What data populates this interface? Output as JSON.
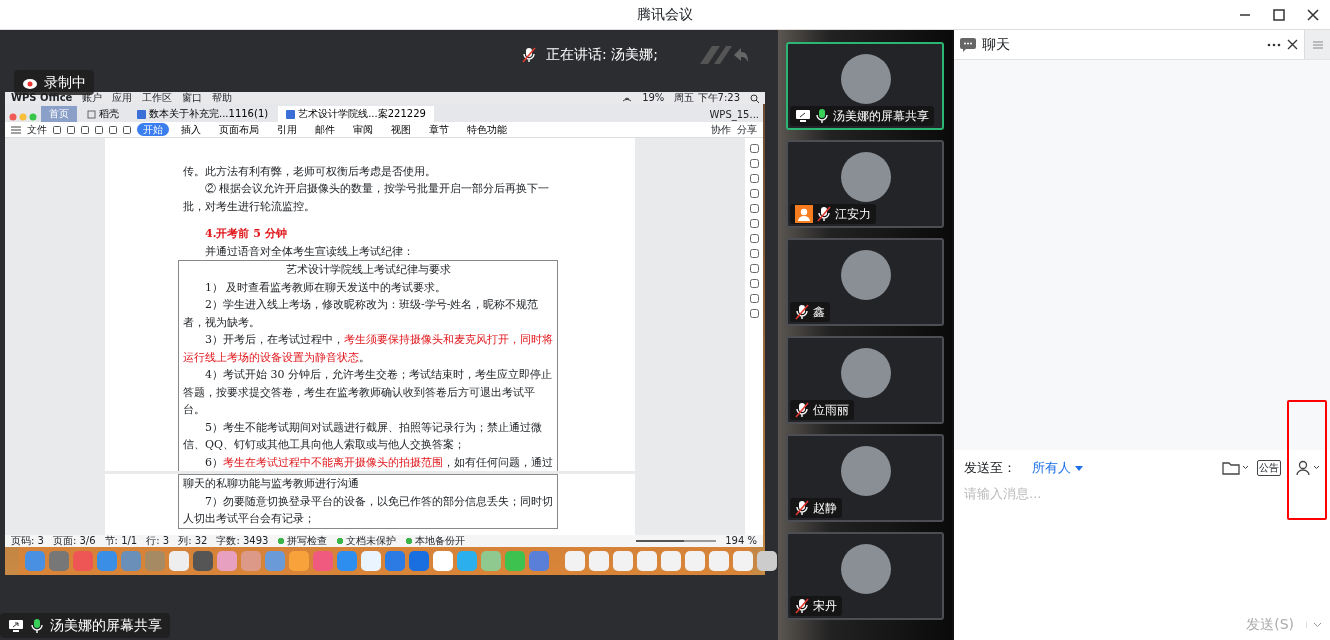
{
  "window": {
    "title": "腾讯会议"
  },
  "share": {
    "recording_label": "录制中",
    "speaker_label": "正在讲话: 汤美娜;",
    "presenter_label": "汤美娜的屏幕共享",
    "screen": {
      "menubar": {
        "app": "WPS Office",
        "menus": [
          "账户",
          "应用",
          "工作区",
          "窗口",
          "帮助"
        ],
        "battery": "19%",
        "clock": "周五 下午7:23"
      },
      "tabs": [
        {
          "label": "首页",
          "kind": "home",
          "selected": false
        },
        {
          "label": "稻壳",
          "kind": "store",
          "selected": false
        },
        {
          "label": "数本关于补充完...1116(1)",
          "kind": "doc",
          "selected": false
        },
        {
          "label": "艺术设计学院线...案221229",
          "kind": "doc",
          "selected": true
        }
      ],
      "account": "WPS_15...",
      "ribbon": {
        "file": "文件",
        "items": [
          {
            "label": "开始",
            "selected": true
          },
          {
            "label": "插入",
            "selected": false
          },
          {
            "label": "页面布局",
            "selected": false
          },
          {
            "label": "引用",
            "selected": false
          },
          {
            "label": "邮件",
            "selected": false
          },
          {
            "label": "审阅",
            "selected": false
          },
          {
            "label": "视图",
            "selected": false
          },
          {
            "label": "章节",
            "selected": false
          },
          {
            "label": "特色功能",
            "selected": false
          }
        ],
        "actions": [
          "协作",
          "分享"
        ]
      },
      "document": {
        "pages": [
          {
            "items": [
              {
                "kind": "continuation",
                "parts": [
                  {
                    "text": "传。此方法有利有弊，老师可权衡后考虑是否使用。",
                    "red": false
                  }
                ]
              },
              {
                "kind": "body",
                "parts": [
                  {
                    "text": "② 根据会议允许开启摄像头的数量，按学号批量开启一部分后再换下一批，对考生进行轮流监控。",
                    "red": false
                  }
                ]
              },
              {
                "kind": "heading",
                "parts": [
                  {
                    "text": "4.开考前 5 分钟",
                    "red": true
                  }
                ]
              },
              {
                "kind": "body",
                "parts": [
                  {
                    "text": "并通过语音对全体考生宣读线上考试纪律：",
                    "red": false
                  }
                ]
              },
              {
                "kind": "box",
                "items": [
                  {
                    "kind": "title",
                    "parts": [
                      {
                        "text": "艺术设计学院线上考试纪律与要求",
                        "red": false
                      }
                    ]
                  },
                  {
                    "kind": "body",
                    "parts": [
                      {
                        "text": "1） 及时查看监考教师在聊天发送中的考试要求。",
                        "red": false
                      }
                    ]
                  },
                  {
                    "kind": "body",
                    "parts": [
                      {
                        "text": "2）学生进入线上考场，修改昵称改为：班级-学号-姓名，昵称不规范者，视为缺考。",
                        "red": false
                      }
                    ]
                  },
                  {
                    "kind": "body",
                    "parts": [
                      {
                        "text": "3）开考后，在考试过程中，",
                        "red": false
                      },
                      {
                        "text": "考生须要保持摄像头和麦克风打开，同时将运行线上考场的设备设置为静音状态",
                        "red": true
                      },
                      {
                        "text": "。",
                        "red": false
                      }
                    ]
                  },
                  {
                    "kind": "body",
                    "parts": [
                      {
                        "text": "4）考试开始 30 分钟后，允许考生交卷；考试结束时，考生应立即停止答题，按要求提交答卷，考生在监考教师确认收到答卷后方可退出考试平台。",
                        "red": false
                      }
                    ]
                  },
                  {
                    "kind": "body",
                    "parts": [
                      {
                        "text": "5）考生不能考试期间对试题进行截屏、拍照等记录行为；禁止通过微信、QQ、钉钉或其他工具向他人索取或与他人交换答案；",
                        "red": false
                      }
                    ]
                  },
                  {
                    "kind": "body",
                    "parts": [
                      {
                        "text": "6）",
                        "red": false
                      },
                      {
                        "text": "考生在考试过程中不能离开摄像头的拍摄范围",
                        "red": true
                      },
                      {
                        "text": "，如有任何问题，通过",
                        "red": false
                      }
                    ]
                  }
                ]
              }
            ]
          },
          {
            "items": [
              {
                "kind": "box",
                "items": [
                  {
                    "kind": "continuation",
                    "parts": [
                      {
                        "text": "聊天的私聊功能与监考教师进行沟通",
                        "red": false
                      }
                    ]
                  },
                  {
                    "kind": "body",
                    "parts": [
                      {
                        "text": "7）勿要随意切换登录平台的设备，以免已作答的部分信息丢失；同时切人切出考试平台会有记录；",
                        "red": false
                      }
                    ]
                  }
                ]
              }
            ]
          }
        ]
      },
      "status": [
        "页码: 3",
        "页面: 3/6",
        "节: 1/1",
        "行: 3",
        "列: 32",
        "字数: 3493"
      ],
      "status_checks": [
        "拼写检查",
        "文档未保护",
        "本地备份开"
      ],
      "zoom": {
        "label": "194 %",
        "level": 0.6
      }
    }
  },
  "participants": [
    {
      "name": "汤美娜的屏幕共享",
      "sharing": true,
      "host": false,
      "muted": false,
      "selected": true
    },
    {
      "name": "江安力",
      "sharing": false,
      "host": true,
      "muted": true,
      "selected": false
    },
    {
      "name": "鑫",
      "sharing": false,
      "host": false,
      "muted": true,
      "selected": false
    },
    {
      "name": "位雨丽",
      "sharing": false,
      "host": false,
      "muted": true,
      "selected": false
    },
    {
      "name": "赵静",
      "sharing": false,
      "host": false,
      "muted": true,
      "selected": false
    },
    {
      "name": "宋丹",
      "sharing": false,
      "host": false,
      "muted": true,
      "selected": false
    }
  ],
  "chat": {
    "title": "聊天",
    "send_to_label": "发送至：",
    "recipient": "所有人",
    "notice_label": "公告",
    "placeholder": "请输入消息...",
    "send_button": {
      "label": "发送(S)",
      "disabled": true
    }
  }
}
